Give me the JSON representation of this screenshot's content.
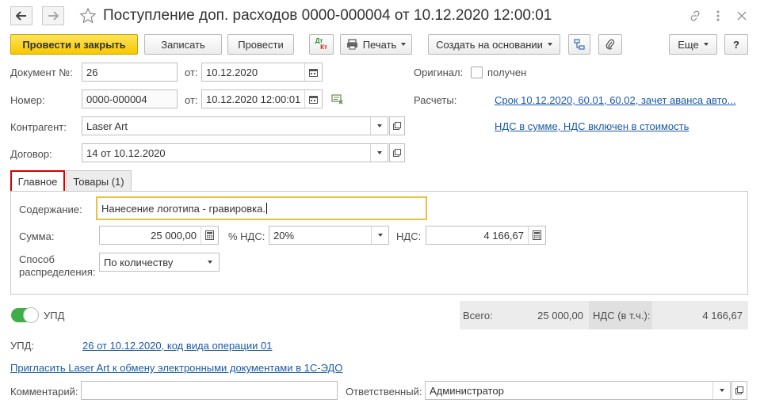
{
  "window": {
    "title": "Поступление доп. расходов 0000-000004 от 10.12.2020 12:00:01"
  },
  "toolbar": {
    "post_close": "Провести и закрыть",
    "save": "Записать",
    "post": "Провести",
    "dtkt_dt": "Дт",
    "dtkt_kt": "Кт",
    "print": "Печать",
    "create_based": "Создать на основании",
    "more": "Еще",
    "help": "?"
  },
  "header": {
    "doc_no_label": "Документ №:",
    "doc_no_value": "26",
    "doc_date_label": "от:",
    "doc_date_value": "10.12.2020",
    "number_label": "Номер:",
    "number_value": "0000-000004",
    "number_date_label": "от:",
    "number_date_value": "10.12.2020 12:00:01",
    "counterparty_label": "Контрагент:",
    "counterparty_value": "Laser Art",
    "contract_label": "Договор:",
    "contract_value": "14 от 10.12.2020",
    "original_label": "Оригинал:",
    "received_label": "получен",
    "settlements_label": "Расчеты:",
    "settlements_link": "Срок 10.12.2020, 60.01, 60.02, зачет аванса авто...",
    "vat_link": "НДС в сумме, НДС включен в стоимость"
  },
  "tabs": [
    {
      "label": "Главное",
      "active": true
    },
    {
      "label": "Товары (1)",
      "active": false
    }
  ],
  "main_tab": {
    "content_label": "Содержание:",
    "content_value": "Нанесение логотипа - гравировка.",
    "sum_label": "Сумма:",
    "sum_value": "25 000,00",
    "vat_rate_label": "% НДС:",
    "vat_rate_value": "20%",
    "vat_label": "НДС:",
    "vat_value": "4 166,67",
    "distribution_label_1": "Способ",
    "distribution_label_2": "распределения:",
    "distribution_value": "По количеству"
  },
  "upd_toggle": {
    "label": "УПД",
    "on": true
  },
  "totals": {
    "total_label": "Всего:",
    "total_value": "25 000,00",
    "vat_label": "НДС (в т.ч.):",
    "vat_value": "4 166,67"
  },
  "footer": {
    "upd_label": "УПД:",
    "upd_link": "26 от 10.12.2020, код вида операции 01",
    "invite_link": "Пригласить Laser Art к обмену электронными документами в 1С-ЭДО",
    "comment_label": "Комментарий:",
    "comment_value": "",
    "responsible_label": "Ответственный:",
    "responsible_value": "Администратор"
  },
  "colors": {
    "primary_button": "#f6c900",
    "link": "#1a5aa6",
    "toggle_on": "#3fae49",
    "active_tab_border": "#d40000",
    "focused_input_border": "#e8c240"
  }
}
